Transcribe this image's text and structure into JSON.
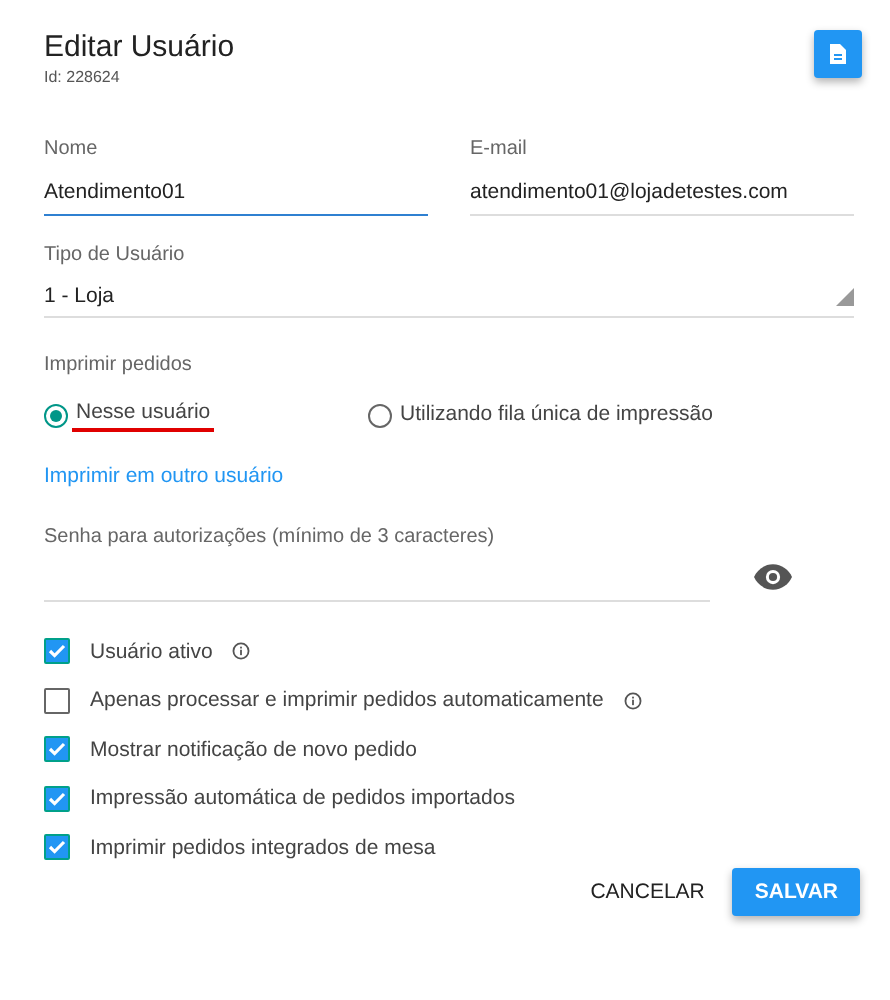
{
  "header": {
    "title": "Editar Usuário",
    "subtitle": "Id: 228624"
  },
  "fields": [
    {
      "label": "Nome",
      "value": "Atendimento01",
      "focused": true
    },
    {
      "label": "E-mail",
      "value": "atendimento01@lojadetestes.com",
      "focused": false
    }
  ],
  "select": {
    "label": "Tipo de Usuário",
    "value": "1 - Loja"
  },
  "print": {
    "label": "Imprimir pedidos",
    "options": [
      {
        "label": "Nesse usuário",
        "selected": true,
        "underlined": true
      },
      {
        "label": "Utilizando fila única de impressão",
        "selected": false,
        "underlined": false
      }
    ],
    "link": "Imprimir em outro usuário"
  },
  "password": {
    "label": "Senha para autorizações (mínimo de 3 caracteres)"
  },
  "checkboxes": [
    {
      "label": "Usuário ativo",
      "checked": true,
      "info": true
    },
    {
      "label": "Apenas processar e imprimir pedidos automaticamente",
      "checked": false,
      "info": true
    },
    {
      "label": "Mostrar notificação de novo pedido",
      "checked": true,
      "info": false
    },
    {
      "label": "Impressão automática de pedidos importados",
      "checked": true,
      "info": false
    },
    {
      "label": "Imprimir pedidos integrados de mesa",
      "checked": true,
      "info": false
    }
  ],
  "buttons": [
    {
      "label": "CANCELAR",
      "kind": "text"
    },
    {
      "label": "SALVAR",
      "kind": "primary"
    }
  ]
}
